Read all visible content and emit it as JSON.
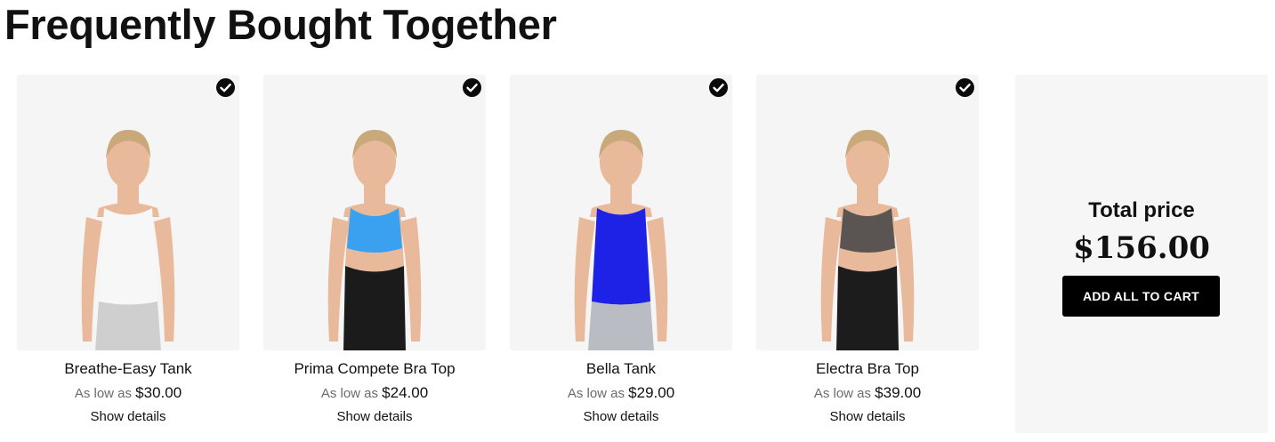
{
  "title": "Frequently Bought Together",
  "products": [
    {
      "name": "Breathe-Easy Tank",
      "price_prefix": "As low as",
      "price": "$30.00",
      "details": "Show details",
      "checked": true,
      "top_color": "#f7f7f7",
      "bottom_color": "#cfcfcf",
      "image_icon": "woman-white-tank-photo"
    },
    {
      "name": "Prima Compete Bra Top",
      "price_prefix": "As low as",
      "price": "$24.00",
      "details": "Show details",
      "checked": true,
      "top_color": "#3aa0f0",
      "bottom_color": "#1b1b1b",
      "image_icon": "woman-blue-bra-top-photo"
    },
    {
      "name": "Bella Tank",
      "price_prefix": "As low as",
      "price": "$29.00",
      "details": "Show details",
      "checked": true,
      "top_color": "#1e22e6",
      "bottom_color": "#b9bcc2",
      "image_icon": "woman-blue-tank-photo"
    },
    {
      "name": "Electra Bra Top",
      "price_prefix": "As low as",
      "price": "$39.00",
      "details": "Show details",
      "checked": true,
      "top_color": "#5a5552",
      "bottom_color": "#1c1c1c",
      "image_icon": "woman-grey-bra-top-photo"
    }
  ],
  "total": {
    "label": "Total price",
    "price": "$156.00",
    "button_label": "ADD ALL TO CART"
  },
  "colors": {
    "check_bg": "#0b0b0b",
    "image_bg": "#f5f5f5",
    "panel_bg": "#f6f6f6",
    "button_bg": "#000000",
    "skin": "#e9b99b",
    "hair": "#c9a87a"
  }
}
